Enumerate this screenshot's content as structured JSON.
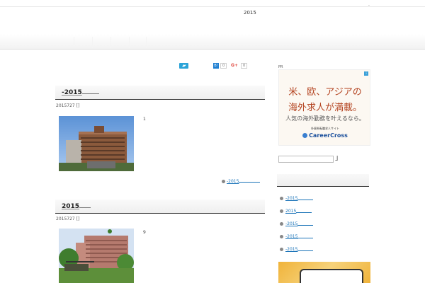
{
  "header": {
    "site_title": "2015",
    "top_mark": "."
  },
  "share": {
    "twitter_icon": "twitter-icon",
    "hatena_label": "B!",
    "hatena_count": "0",
    "google_label": "G+",
    "google_count": "0"
  },
  "posts": [
    {
      "title": "-2015",
      "date": "2015727 []",
      "excerpt": "1",
      "more_label": "-2015"
    },
    {
      "title": "2015",
      "date": "2015727 []",
      "excerpt": "9"
    }
  ],
  "sidebar": {
    "pr_label": "PR",
    "ad": {
      "line1": "米、欧、アジアの",
      "line2": "海外求人が満載。",
      "line3": "人気の海外勤務を叶えるなら。",
      "small": "外資系転職求人サイト",
      "logo": "CareerCross"
    },
    "search_button": "」",
    "items": [
      {
        "label": "-2015"
      },
      {
        "label": "2015"
      },
      {
        "label": "-2015"
      },
      {
        "label": "-2015"
      },
      {
        "label": "-2015"
      }
    ]
  }
}
